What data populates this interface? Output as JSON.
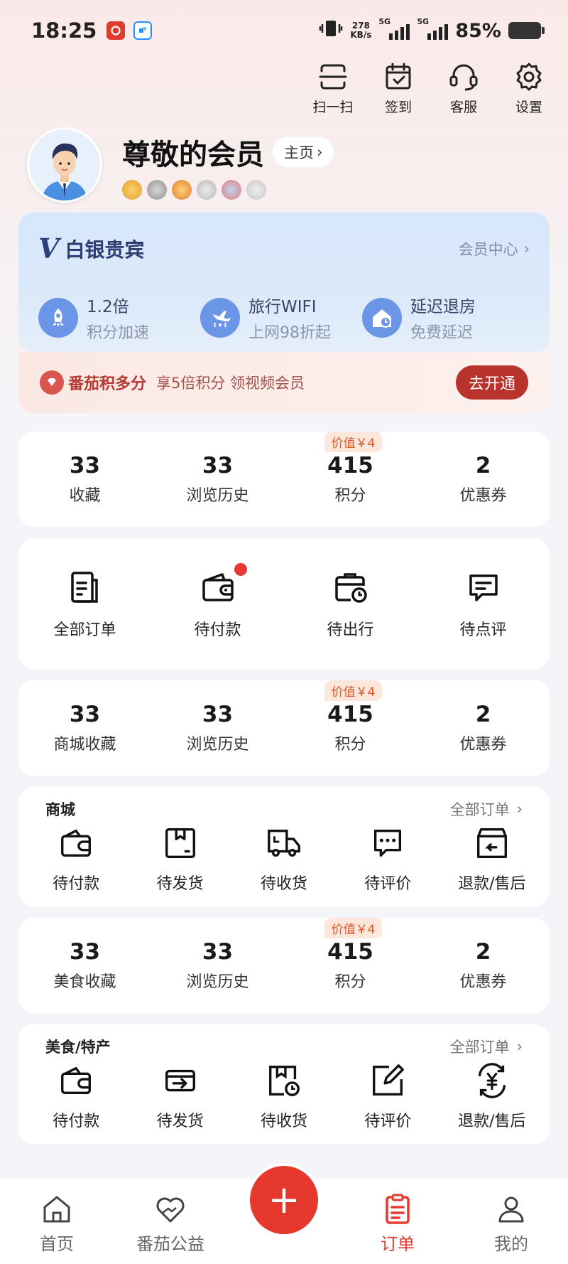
{
  "status": {
    "time": "18:25",
    "net_speed_value": "278",
    "net_speed_unit": "KB/s",
    "sim1": "5G",
    "sim2": "5G",
    "battery": "85%"
  },
  "toolbar": [
    {
      "label": "扫一扫",
      "icon": "scan-icon"
    },
    {
      "label": "签到",
      "icon": "calendar-check-icon"
    },
    {
      "label": "客服",
      "icon": "headset-icon"
    },
    {
      "label": "设置",
      "icon": "gear-icon"
    }
  ],
  "profile": {
    "name": "尊敬的会员",
    "home_label": "主页"
  },
  "vip": {
    "logo": "V",
    "title": "白银贵宾",
    "center_label": "会员中心",
    "benefits": [
      {
        "title": "1.2倍",
        "sub": "积分加速",
        "icon": "rocket-icon"
      },
      {
        "title": "旅行WIFI",
        "sub": "上网98折起",
        "icon": "plane-wifi-icon"
      },
      {
        "title": "延迟退房",
        "sub": "免费延迟",
        "icon": "house-clock-icon"
      }
    ]
  },
  "promo": {
    "brand": "番茄积多分",
    "text": "享5倍积分 领视频会员",
    "button": "去开通"
  },
  "stats_1": {
    "tag": "价值￥4",
    "items": [
      {
        "num": "33",
        "label": "收藏"
      },
      {
        "num": "33",
        "label": "浏览历史"
      },
      {
        "num": "415",
        "label": "积分"
      },
      {
        "num": "2",
        "label": "优惠券"
      }
    ]
  },
  "orders": [
    {
      "label": "全部订单",
      "icon": "document-icon"
    },
    {
      "label": "待付款",
      "icon": "wallet-icon"
    },
    {
      "label": "待出行",
      "icon": "luggage-clock-icon"
    },
    {
      "label": "待点评",
      "icon": "comment-icon"
    }
  ],
  "stats_2": {
    "tag": "价值￥4",
    "items": [
      {
        "num": "33",
        "label": "商城收藏"
      },
      {
        "num": "33",
        "label": "浏览历史"
      },
      {
        "num": "415",
        "label": "积分"
      },
      {
        "num": "2",
        "label": "优惠券"
      }
    ]
  },
  "mall": {
    "title": "商城",
    "more": "全部订单",
    "items": [
      {
        "label": "待付款",
        "icon": "wallet-icon"
      },
      {
        "label": "待发货",
        "icon": "package-icon"
      },
      {
        "label": "待收货",
        "icon": "truck-icon"
      },
      {
        "label": "待评价",
        "icon": "chat-dots-icon"
      },
      {
        "label": "退款/售后",
        "icon": "return-box-icon"
      }
    ]
  },
  "stats_3": {
    "tag": "价值￥4",
    "items": [
      {
        "num": "33",
        "label": "美食收藏"
      },
      {
        "num": "33",
        "label": "浏览历史"
      },
      {
        "num": "415",
        "label": "积分"
      },
      {
        "num": "2",
        "label": "优惠券"
      }
    ]
  },
  "food": {
    "title": "美食/特产",
    "more": "全部订单",
    "items": [
      {
        "label": "待付款",
        "icon": "wallet-icon"
      },
      {
        "label": "待发货",
        "icon": "card-arrow-icon"
      },
      {
        "label": "待收货",
        "icon": "box-clock-icon"
      },
      {
        "label": "待评价",
        "icon": "edit-icon"
      },
      {
        "label": "退款/售后",
        "icon": "yen-refund-icon"
      }
    ]
  },
  "tabbar": [
    {
      "label": "首页",
      "icon": "home-icon"
    },
    {
      "label": "番茄公益",
      "icon": "heart-hands-icon"
    },
    {
      "label": "订单",
      "icon": "clipboard-icon"
    },
    {
      "label": "我的",
      "icon": "user-icon"
    }
  ],
  "colors": {
    "accent_red": "#e5392e",
    "vip_blue": "#6b95e6",
    "tag_orange": "#d9572c"
  }
}
